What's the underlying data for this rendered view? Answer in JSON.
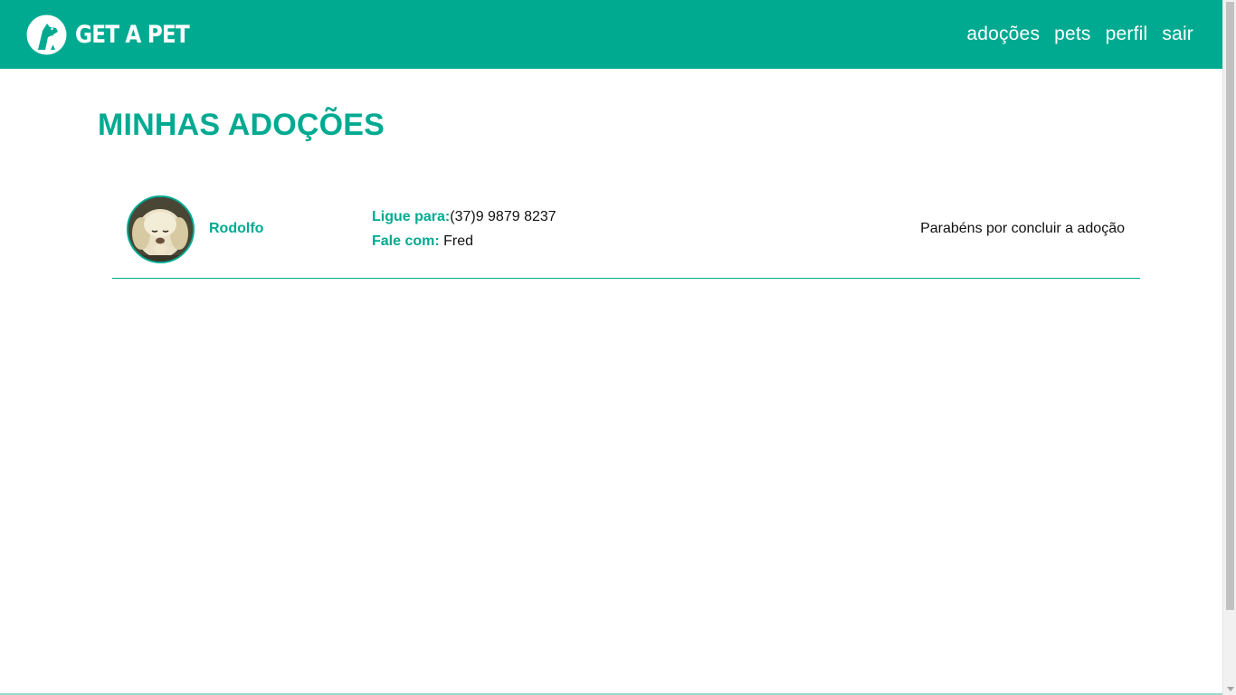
{
  "header": {
    "brand": "GET A PET",
    "nav": [
      {
        "label": "adoções"
      },
      {
        "label": "pets"
      },
      {
        "label": "perfil"
      },
      {
        "label": "sair"
      }
    ]
  },
  "main": {
    "title": "MINHAS ADOÇÕES",
    "adoptions": [
      {
        "pet_name": "Rodolfo",
        "phone_label": "Ligue para:",
        "phone": "(37)9 9879 8237",
        "owner_label": "Fale com:",
        "owner": "Fred",
        "status": "Parabéns por concluir a adoção"
      }
    ]
  },
  "colors": {
    "accent": "#00aa91",
    "text": "#111111",
    "background": "#ffffff"
  },
  "icons": {
    "logo": "dog-cat-logo-icon"
  }
}
